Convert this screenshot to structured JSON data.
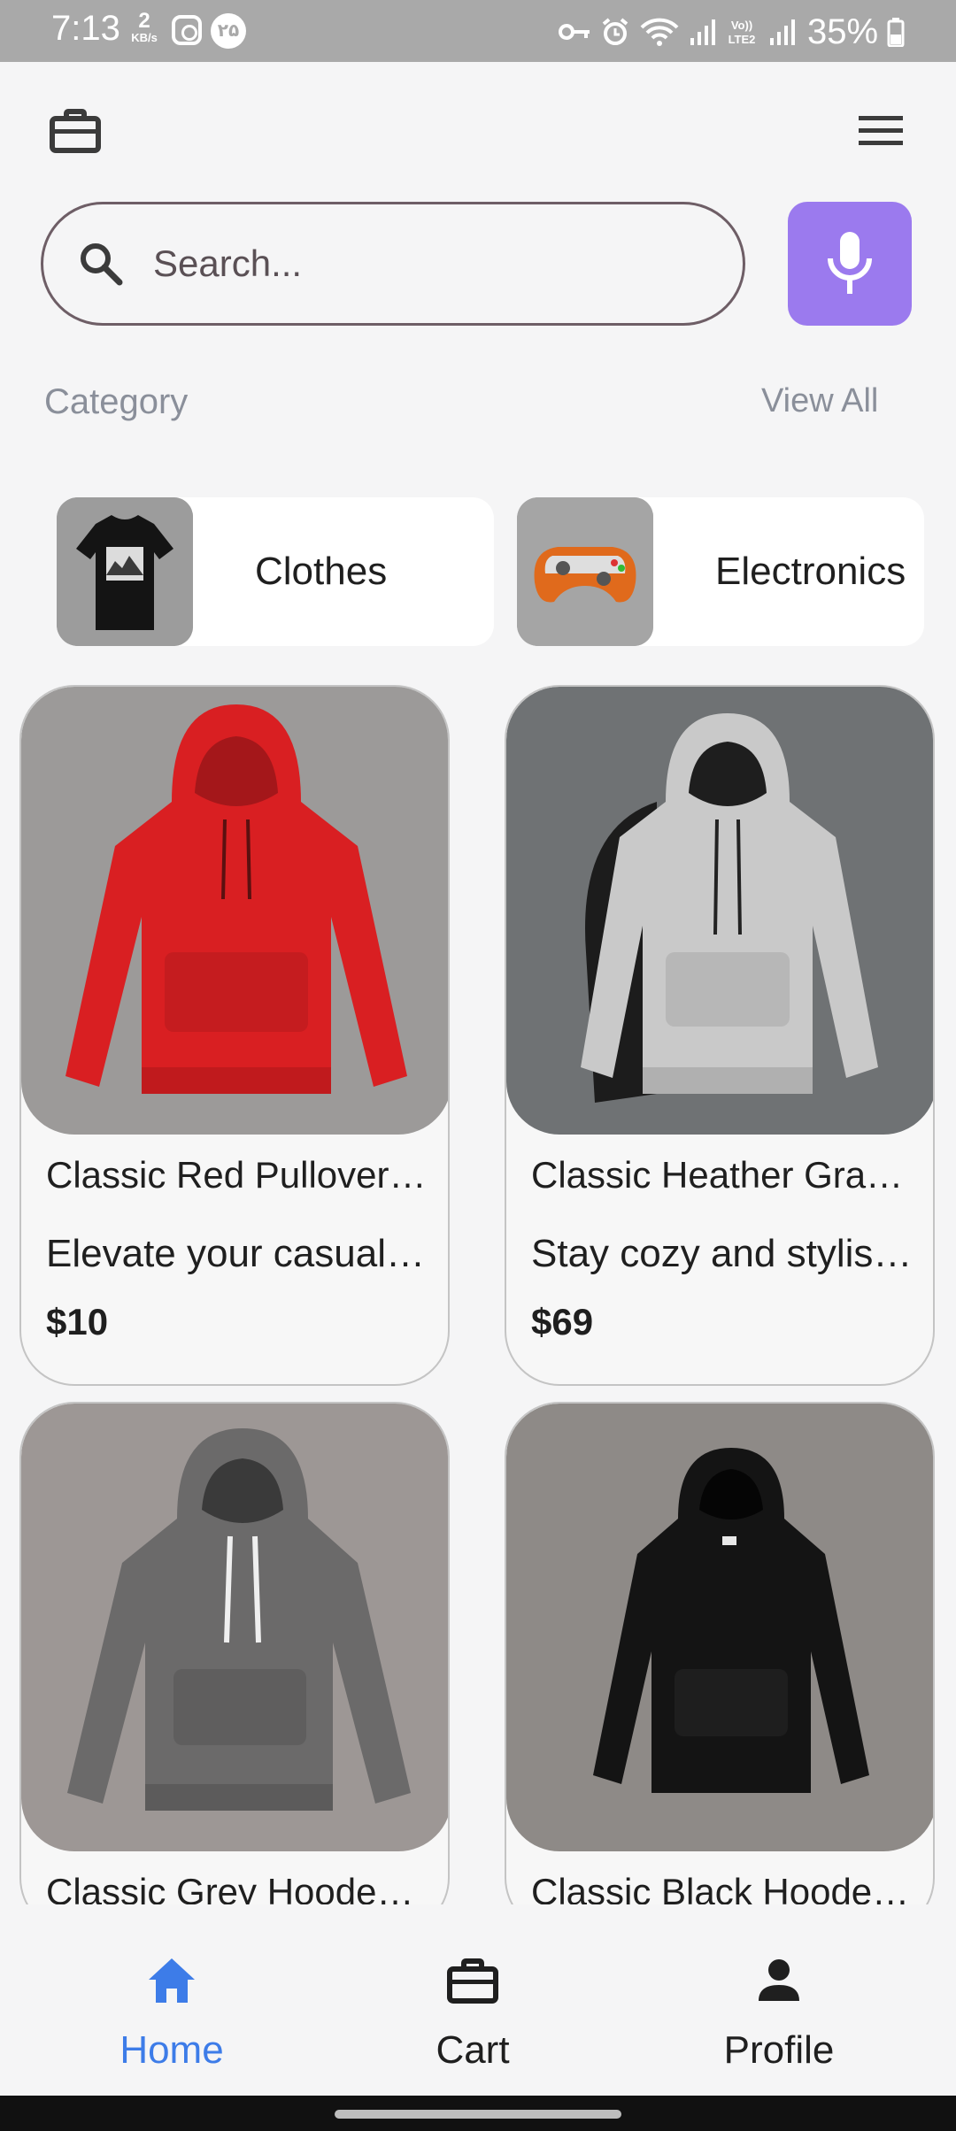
{
  "status_bar": {
    "time": "7:13",
    "net_speed_value": "2",
    "net_speed_unit": "KB/s",
    "notification_badge": "۲۵",
    "battery_percent": "35%"
  },
  "header": {
    "left_icon": "briefcase-icon",
    "right_icon": "menu-icon"
  },
  "search": {
    "placeholder": "Search..."
  },
  "category_section": {
    "title": "Category",
    "view_all": "View All",
    "items": [
      {
        "label": "Clothes",
        "image": "black mountain t-shirt"
      },
      {
        "label": "Electronics",
        "image": "orange game controller"
      }
    ]
  },
  "products": [
    {
      "title": "Classic Red Pullover…",
      "description": "Elevate your casual …",
      "price": "$10"
    },
    {
      "title": "Classic Heather Gra…",
      "description": "Stay cozy and stylis…",
      "price": "$69"
    },
    {
      "title": "Classic Grey Hoode…",
      "description": "",
      "price": ""
    },
    {
      "title": "Classic Black Hoode…",
      "description": "",
      "price": ""
    }
  ],
  "bottom_nav": {
    "items": [
      {
        "label": "Home",
        "icon": "home-icon",
        "active": true
      },
      {
        "label": "Cart",
        "icon": "briefcase-icon",
        "active": false
      },
      {
        "label": "Profile",
        "icon": "person-icon",
        "active": false
      }
    ]
  },
  "colors": {
    "accent": "#9b7aee",
    "active_nav": "#3d7ce8",
    "background": "#f5f5f6"
  }
}
